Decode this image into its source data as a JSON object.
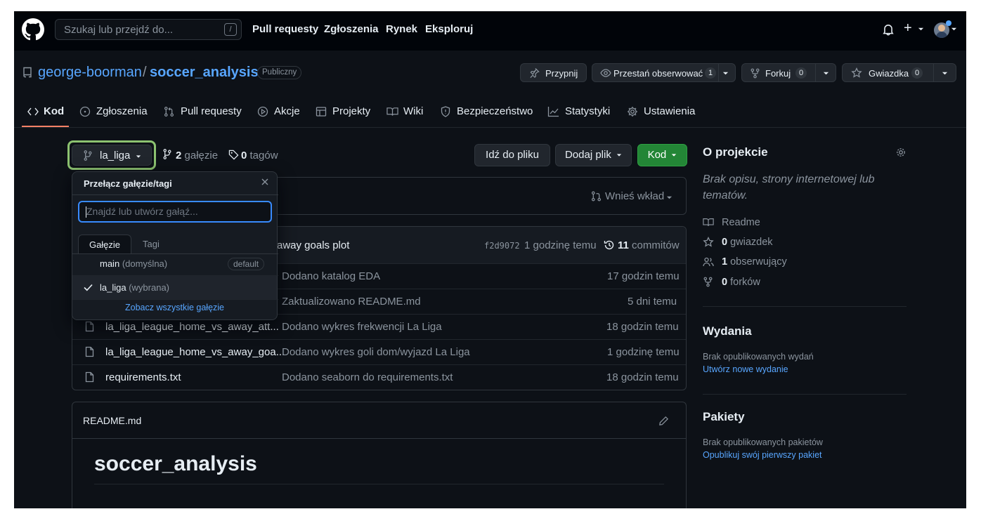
{
  "header": {
    "search_placeholder": "Szukaj lub przejdź do...",
    "search_shortcut": "/",
    "nav": [
      "Pull requesty",
      "Zgłoszenia",
      "Rynek",
      "Eksploruj"
    ],
    "add_label": "+"
  },
  "repo": {
    "owner": "george-boorman",
    "slash": "/",
    "name": "soccer_analysis",
    "visibility": "Publiczny",
    "pin_label": "Przypnij",
    "watch_label": "Przestań obserwować",
    "watch_count": "1",
    "fork_label": "Forkuj",
    "fork_count": "0",
    "star_label": "Gwiazdka",
    "star_count": "0"
  },
  "tabs": [
    "Kod",
    "Zgłoszenia",
    "Pull requesty",
    "Akcje",
    "Projekty",
    "Wiki",
    "Bezpieczeństwo",
    "Statystyki",
    "Ustawienia"
  ],
  "branch": {
    "current": "la_liga",
    "branches_count": "2",
    "branches_label": "gałęzie",
    "tags_count": "0",
    "tags_label": "tagów"
  },
  "actions": {
    "go_to_file": "Idź do pliku",
    "add_file": "Dodaj plik",
    "code": "Kod"
  },
  "contribute_label": "Wnieś wkład",
  "latest_commit": {
    "message_tail": "away goals plot",
    "sha": "f2d9072",
    "time": "1 godzinę temu",
    "commits_count": "11",
    "commits_label": "commitów"
  },
  "files": [
    {
      "name": "",
      "message": "Dodano katalog EDA",
      "time": "17 godzin temu",
      "type": "folder"
    },
    {
      "name": "",
      "message": "Zaktualizowano README.md",
      "time": "5 dni temu",
      "type": "file"
    },
    {
      "name": "la_liga_league_home_vs_away_att...",
      "message": "Dodano wykres frekwencji La Liga",
      "time": "18 godzin temu",
      "type": "file"
    },
    {
      "name": "la_liga_league_home_vs_away_goa...",
      "message": "Dodano wykres goli dom/wyjazd La Liga",
      "time": "1 godzinę temu",
      "type": "file"
    },
    {
      "name": "requirements.txt",
      "message": "Dodano seaborn do requirements.txt",
      "time": "18 godzin temu",
      "type": "file"
    }
  ],
  "dropdown": {
    "title": "Przełącz gałęzie/tagi",
    "placeholder": "Znajdź lub utwórz gałąź...",
    "tab_branches": "Gałęzie",
    "tab_tags": "Tagi",
    "items": [
      {
        "name": "main",
        "note": "(domyślna)",
        "badge": "default",
        "selected": false
      },
      {
        "name": "la_liga",
        "note": "(wybrana)",
        "badge": "",
        "selected": true
      }
    ],
    "view_all": "Zobacz wszystkie gałęzie"
  },
  "readme": {
    "filename": "README.md",
    "heading": "soccer_analysis"
  },
  "sidebar": {
    "about_title": "O projekcie",
    "about_text": "Brak opisu, strony internetowej lub tematów.",
    "readme_label": "Readme",
    "stars_count": "0",
    "stars_label": "gwiazdek",
    "watchers_count": "1",
    "watchers_label": "obserwujący",
    "forks_count": "0",
    "forks_label": "forków",
    "releases_title": "Wydania",
    "releases_text": "Brak opublikowanych wydań",
    "releases_link": "Utwórz nowe wydanie",
    "packages_title": "Pakiety",
    "packages_text": "Brak opublikowanych pakietów",
    "packages_link": "Opublikuj swój pierwszy pakiet"
  },
  "colors": {
    "background": "#0d1117",
    "header": "#010409",
    "link": "#58a6ff",
    "green": "#238636",
    "focus_ring": "#8cc270",
    "tab_underline": "#f78166"
  }
}
